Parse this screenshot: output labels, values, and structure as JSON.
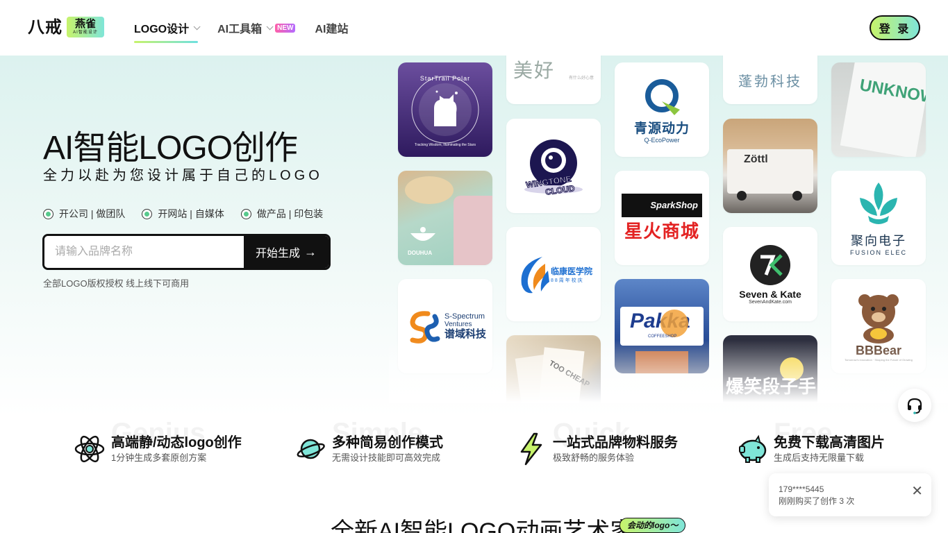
{
  "header": {
    "brand_main": "八戒",
    "brand_badge": "燕雀",
    "brand_badge_sub": "AI智能设计",
    "nav": [
      {
        "label": "LOGO设计"
      },
      {
        "label": "AI工具箱",
        "badge": "NEW"
      },
      {
        "label": "AI建站"
      }
    ],
    "login_label": "登 录"
  },
  "hero": {
    "title": "AI智能LOGO创作",
    "subtitle": "全力以赴为您设计属于自己的LOGO",
    "chips": [
      "开公司 | 做团队",
      "开网站 | 自媒体",
      "做产品 | 印包装"
    ],
    "search_placeholder": "请输入品牌名称",
    "search_button": "开始生成",
    "note": "全部LOGO版权授权 线上线下可商用"
  },
  "wall": {
    "tiles": {
      "startrail": {
        "ring": "StarTrail Polar",
        "sub": "Tracking Wisdom, Illuminating the Stars"
      },
      "douhua": {
        "label": "DOUHUA"
      },
      "spectrum": {
        "name": "S-Spectrum",
        "name2": "Ventures",
        "cn": "谱域科技"
      },
      "meihao": {
        "text": "美好",
        "small": "有什么好心意"
      },
      "wingtone": {
        "line1": "WINGTONE",
        "line2": "CLOUD"
      },
      "linkang": {
        "cn": "临康医学院",
        "sub": "88周年校庆"
      },
      "cheap": {
        "text": "TOO CHEAP"
      },
      "qingyuan": {
        "cn": "青源动力",
        "en": "Q-EcoPower"
      },
      "sparkshop": {
        "en": "SparkShop",
        "cn": "星火商城"
      },
      "pakka": {
        "en": "Pakka",
        "sub": "COFFEESHOP"
      },
      "pengbo": {
        "cn": "蓬勃科技"
      },
      "zottl": {
        "text": "Zöttl"
      },
      "sevenkate": {
        "name": "Seven & Kate",
        "url": "SevenAndKate.com"
      },
      "baoxiao": {
        "cn": "爆笑段子手"
      },
      "fusion": {
        "cn": "聚向电子",
        "en": "FUSION ELEC"
      },
      "bbbear": {
        "name": "BBBear",
        "sub": "Tomorrow's innovation · Shaping the Future of Growing"
      },
      "bag": {
        "text": "UNKNOWN"
      }
    }
  },
  "features": [
    {
      "title": "高端静/动态logo创作",
      "desc": "1分钟生成多套原创方案",
      "ghost": "Genius"
    },
    {
      "title": "多种简易创作模式",
      "desc": "无需设计技能即可高效完成",
      "ghost": "Simple"
    },
    {
      "title": "一站式品牌物料服务",
      "desc": "极致舒畅的服务体验",
      "ghost": "Quick"
    },
    {
      "title": "免费下载高清图片",
      "desc": "生成后支持无限量下载",
      "ghost": "Free"
    }
  ],
  "bottom": {
    "title": "全新AI智能LOGO动画艺术家",
    "tag": "会动的logo～"
  },
  "toast": {
    "user": "179****5445",
    "message": "刚刚购买了创作 3 次"
  },
  "colors": {
    "accent_green": "#c7f36b",
    "accent_cyan": "#7fe5d8",
    "dot_green": "#57c98d"
  }
}
